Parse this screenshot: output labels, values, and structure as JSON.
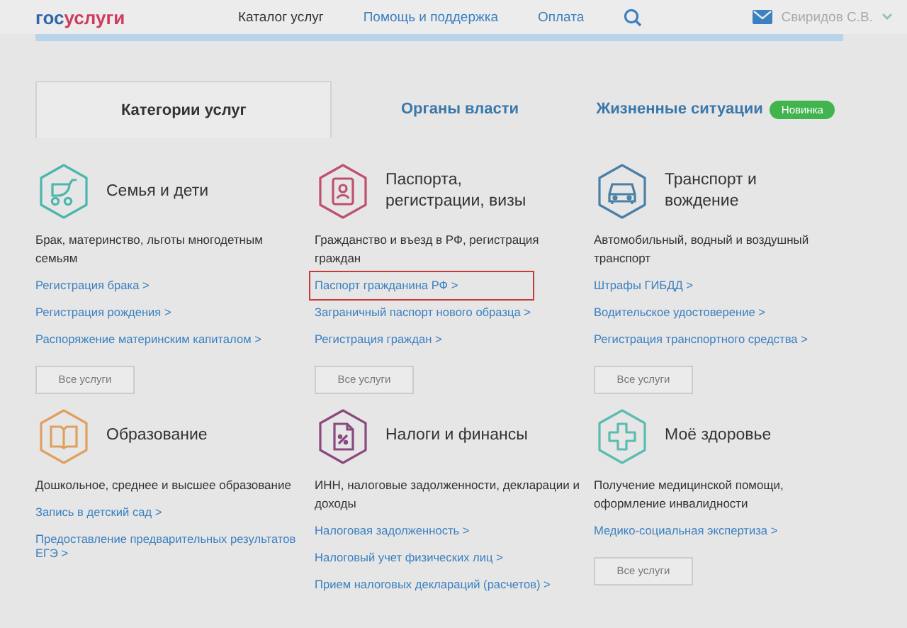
{
  "header": {
    "logo": {
      "part_1": "гос",
      "part_2": "услуги"
    },
    "nav": [
      {
        "label": "Каталог услуг",
        "selected": true
      },
      {
        "label": "Помощь и поддержка",
        "selected": false
      },
      {
        "label": "Оплата",
        "selected": false
      }
    ],
    "user": "Свиридов С.В."
  },
  "tabs": [
    {
      "label": "Категории услуг",
      "selected": true
    },
    {
      "label": "Органы власти",
      "selected": false
    },
    {
      "label": "Жизненные ситуации",
      "selected": false,
      "badge": "Новинка"
    }
  ],
  "categories": [
    {
      "title": "Семья и дети",
      "color": "#4db6ac",
      "description": "Брак, материнство, льготы многодетным семьям",
      "links": [
        {
          "label": "Регистрация брака >",
          "highlighted": false
        },
        {
          "label": "Регистрация рождения >",
          "highlighted": false
        },
        {
          "label": "Распоряжение материнским капиталом >",
          "highlighted": false
        }
      ],
      "button": "Все услуги"
    },
    {
      "title": "Паспорта, регистрации, визы",
      "color": "#c0506e",
      "description": "Гражданство и въезд в РФ, регистрация граждан",
      "links": [
        {
          "label": "Паспорт гражданина РФ >",
          "highlighted": true
        },
        {
          "label": "Заграничный паспорт нового образца >",
          "highlighted": false
        },
        {
          "label": "Регистрация граждан >",
          "highlighted": false
        }
      ],
      "button": "Все услуги"
    },
    {
      "title": "Транспорт и вождение",
      "color": "#4a7fa7",
      "description": "Автомобильный, водный и воздушный транспорт",
      "links": [
        {
          "label": "Штрафы ГИБДД >",
          "highlighted": false
        },
        {
          "label": "Водительское удостоверение >",
          "highlighted": false
        },
        {
          "label": "Регистрация транспортного средства >",
          "highlighted": false
        }
      ],
      "button": "Все услуги"
    },
    {
      "title": "Образование",
      "color": "#e0a060",
      "description": "Дошкольное, среднее и высшее образование",
      "links": [
        {
          "label": "Запись в детский сад >",
          "highlighted": false
        },
        {
          "label": "Предоставление предварительных результатов ЕГЭ >",
          "highlighted": false
        }
      ]
    },
    {
      "title": "Налоги и финансы",
      "color": "#8a4a80",
      "description": "ИНН, налоговые задолженности, декларации и доходы",
      "links": [
        {
          "label": "Налоговая задолженность >",
          "highlighted": false
        },
        {
          "label": "Налоговый учет физических лиц >",
          "highlighted": false
        },
        {
          "label": "Прием налоговых деклараций (расчетов) >",
          "highlighted": false
        }
      ]
    },
    {
      "title": "Моё здоровье",
      "color": "#5bbcb0",
      "description": "Получение медицинской помощи, оформление инвалидности",
      "links": [
        {
          "label": "Медико-социальная экспертиза >",
          "highlighted": false
        }
      ],
      "button": "Все услуги"
    }
  ]
}
